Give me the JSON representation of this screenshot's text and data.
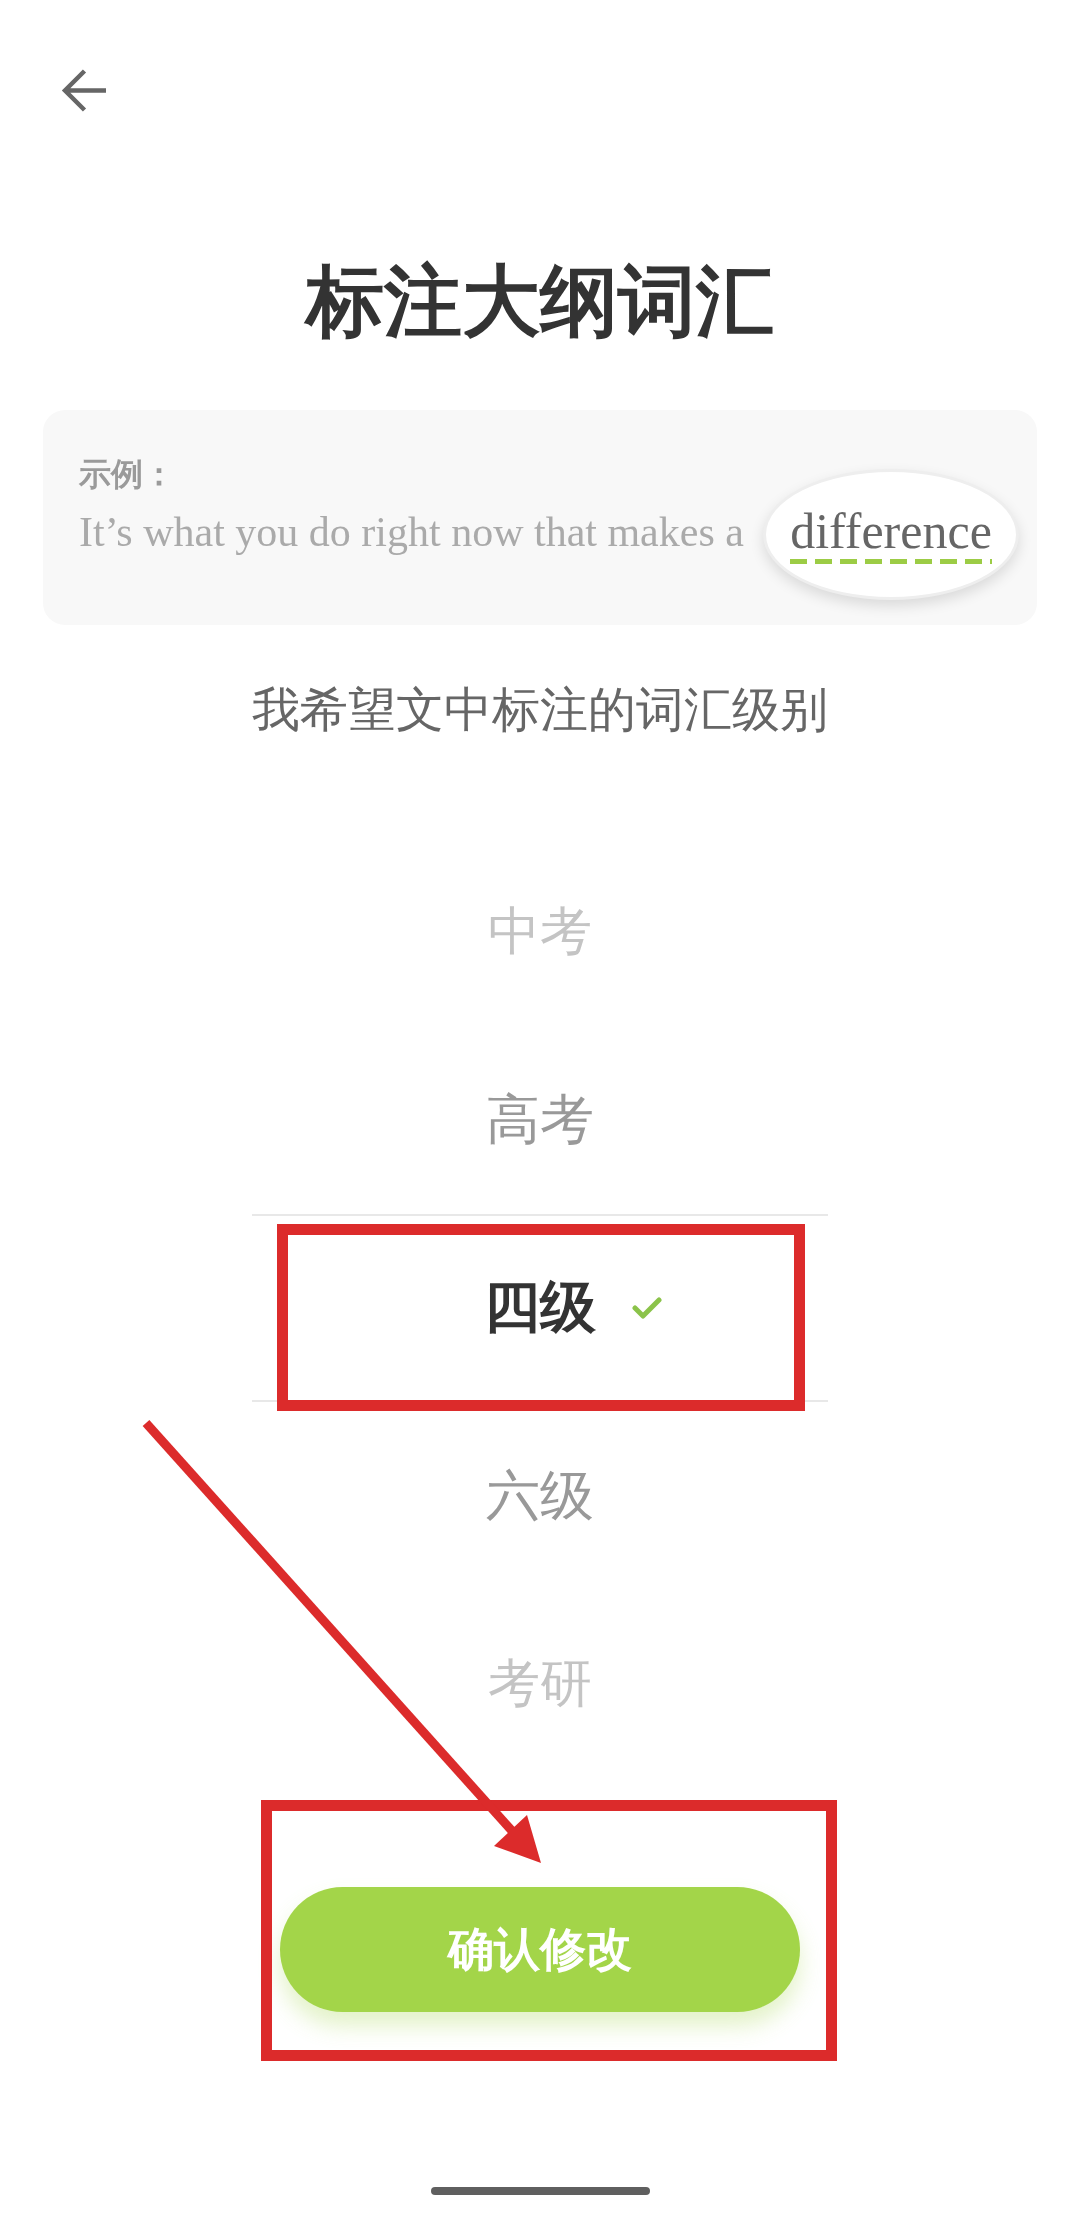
{
  "title": "标注大纲词汇",
  "example": {
    "label": "示例：",
    "sentence": "It’s what you do right now that makes a",
    "highlighted_word": "difference"
  },
  "prompt": "我希望文中标注的词汇级别",
  "levels": [
    {
      "label": "中考",
      "selected": false
    },
    {
      "label": "高考",
      "selected": false
    },
    {
      "label": "四级",
      "selected": true
    },
    {
      "label": "六级",
      "selected": false
    },
    {
      "label": "考研",
      "selected": false
    }
  ],
  "confirm_button": "确认修改"
}
